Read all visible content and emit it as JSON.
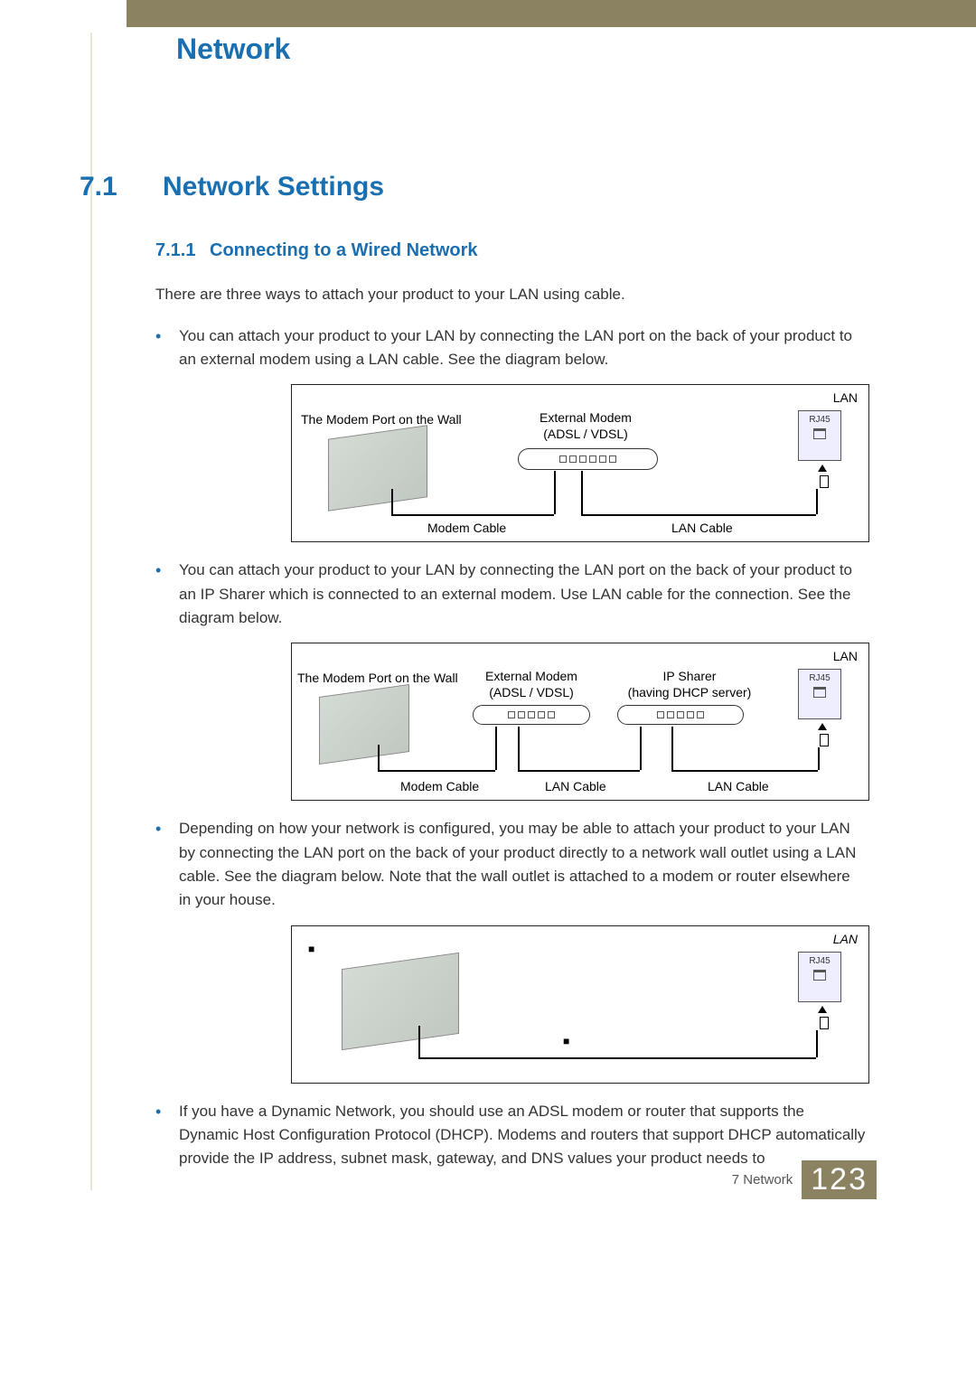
{
  "chapter_title": "Network",
  "section": {
    "number": "7.1",
    "title": "Network Settings"
  },
  "subsection": {
    "number": "7.1.1",
    "title": "Connecting to a Wired Network"
  },
  "intro_para": "There are three ways to attach your product to your LAN using cable.",
  "bullets": [
    "You can attach your product to your LAN by connecting the LAN port on the back of your product to an external modem using a LAN cable. See the diagram below.",
    "You can attach your product to your LAN by connecting the LAN port on the back of your product to an IP Sharer which is connected to an external modem. Use LAN cable for the connection. See the diagram below.",
    "Depending on how your network is configured, you may be able to attach your product to your LAN by connecting the LAN port on the back of your product directly to a network wall outlet using a LAN cable. See the diagram below. Note that the wall outlet is attached to a modem or router elsewhere in your house.",
    "If you have a Dynamic Network, you should use an ADSL modem or router that supports the Dynamic Host Configuration Protocol (DHCP). Modems and routers that support DHCP automatically provide the IP address, subnet mask, gateway, and DNS values your product needs to"
  ],
  "diagram_labels": {
    "wall_port": "The Modem Port on the Wall",
    "external_modem_l1": "External Modem",
    "external_modem_l2": "(ADSL / VDSL)",
    "ip_sharer_l1": "IP Sharer",
    "ip_sharer_l2": "(having DHCP server)",
    "lan": "LAN",
    "rj45": "RJ45",
    "modem_cable": "Modem Cable",
    "lan_cable": "LAN Cable"
  },
  "footer": {
    "label": "7 Network",
    "page": "123"
  }
}
